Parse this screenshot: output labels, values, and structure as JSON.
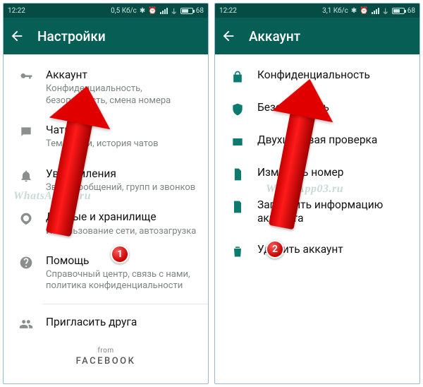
{
  "left": {
    "status": {
      "time": "12:22",
      "net": "0,5 Кб/с",
      "battery": "68"
    },
    "appbar": {
      "title": "Настройки"
    },
    "items": [
      {
        "title": "Аккаунт",
        "sub": "Конфиденциальность, безопасность, смена номера"
      },
      {
        "title": "Чаты",
        "sub": "Тема, обои, история чатов"
      },
      {
        "title": "Уведомления",
        "sub": "Звуки сообщений, групп и звонков"
      },
      {
        "title": "Данные и хранилище",
        "sub": "Использование сети, автозагрузка"
      },
      {
        "title": "Помощь",
        "sub": "Справочный центр, связь с нами, политика конфиденциальности"
      },
      {
        "title": "Пригласить друга",
        "sub": ""
      }
    ],
    "footer": {
      "from": "from",
      "brand": "FACEBOOK"
    },
    "badge": "1"
  },
  "right": {
    "status": {
      "time": "12:22",
      "net": "3,1 Кб/с",
      "battery": "68"
    },
    "appbar": {
      "title": "Аккаунт"
    },
    "items": [
      {
        "title": "Конфиденциальность"
      },
      {
        "title": "Безопасность"
      },
      {
        "title": "Двухшаговая проверка"
      },
      {
        "title": "Изменить номер"
      },
      {
        "title": "Запросить информацию аккаунта"
      },
      {
        "title": "Удалить аккаунт"
      }
    ],
    "badge": "2"
  },
  "watermark": "WhatsApp03.ru"
}
